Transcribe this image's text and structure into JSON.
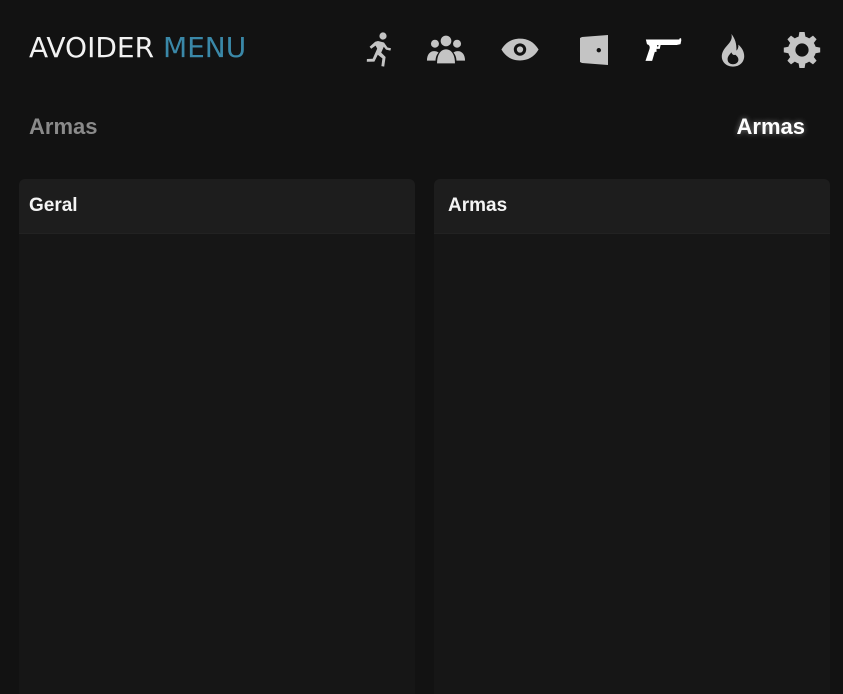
{
  "header": {
    "brand_main": "AVOIDER",
    "brand_accent": "MENU",
    "nav": [
      {
        "icon": "running-person-icon",
        "active": false
      },
      {
        "icon": "users-group-icon",
        "active": false
      },
      {
        "icon": "eye-icon",
        "active": false
      },
      {
        "icon": "door-icon",
        "active": false
      },
      {
        "icon": "pistol-icon",
        "active": true
      },
      {
        "icon": "flame-icon",
        "active": false
      },
      {
        "icon": "gear-icon",
        "active": false
      }
    ]
  },
  "section": {
    "left_title": "Armas",
    "right_title": "Armas"
  },
  "panels": {
    "left_title": "Geral",
    "right_title": "Armas"
  },
  "colors": {
    "background": "#121212",
    "accent": "#3a88a8",
    "panel": "#161616",
    "panel_header": "#1d1d1d"
  }
}
